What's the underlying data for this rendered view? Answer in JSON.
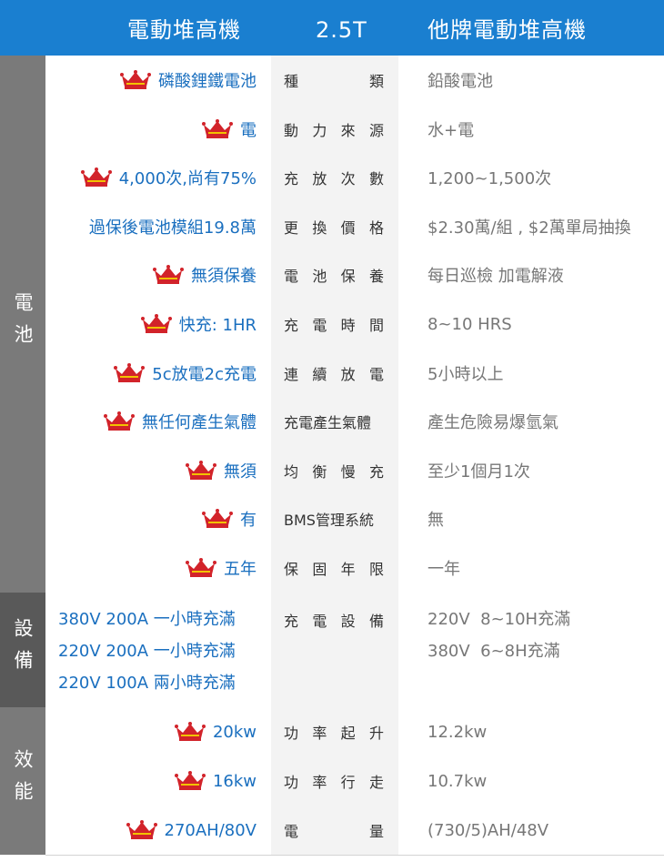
{
  "header": {
    "col1": "電動堆高機",
    "col2": "2.5T",
    "col3": "他牌電動堆高機"
  },
  "colors": {
    "header_bg": "#1a7fd0",
    "highlight": "#1a6fbf",
    "crown_red": "#d2232a",
    "crown_gold": "#f2c200",
    "label_bg": "#f3f3f3",
    "sidebar_battery": "#7a7a7a",
    "sidebar_equip": "#595959",
    "sidebar_perf": "#7a7a7a"
  },
  "sections": {
    "battery": "電池",
    "equipment": "設備",
    "performance": "效能"
  },
  "rows": [
    {
      "ours": "磷酸鋰鐵電池",
      "label": "種類",
      "spaced": true,
      "other": "鉛酸電池",
      "crown": true
    },
    {
      "ours": "電",
      "label": "動力來源",
      "spaced": true,
      "other": "水+電",
      "crown": true
    },
    {
      "ours": "4,000次,尚有75%",
      "label": "充放次數",
      "spaced": true,
      "other": "1,200~1,500次",
      "crown": true
    },
    {
      "ours": "過保後電池模組19.8萬",
      "label": "更換價格",
      "spaced": true,
      "other": "$2.30萬/組 , $2萬單局抽換",
      "crown": false
    },
    {
      "ours": "無須保養",
      "label": "電池保養",
      "spaced": true,
      "other": "每日巡檢 加電解液",
      "crown": true
    },
    {
      "ours": "快充: 1HR",
      "label": "充電時間",
      "spaced": true,
      "other": "8~10 HRS",
      "crown": true
    },
    {
      "ours": "5c放電2c充電",
      "label": "連續放電",
      "spaced": true,
      "other": "5小時以上",
      "crown": true
    },
    {
      "ours": "無任何產生氣體",
      "label": "充電產生氣體",
      "spaced": false,
      "other": "產生危險易爆氫氣",
      "crown": true
    },
    {
      "ours": "無須",
      "label": "均衡慢充",
      "spaced": true,
      "other": "至少1個月1次",
      "crown": true
    },
    {
      "ours": "有",
      "label": "BMS管理系統",
      "spaced": false,
      "other": "無",
      "crown": true
    },
    {
      "ours": "五年",
      "label": "保固年限",
      "spaced": true,
      "other": "一年",
      "crown": true
    }
  ],
  "equipment": {
    "ours": [
      "380V 200A 一小時充滿",
      "220V 200A 一小時充滿",
      "220V 100A 兩小時充滿"
    ],
    "label": "充電設備",
    "other": [
      "220V  8~10H充滿",
      "380V  6~8H充滿"
    ]
  },
  "performance": [
    {
      "ours": "20kw",
      "label": "功率起升",
      "spaced": true,
      "other": "12.2kw",
      "crown": true
    },
    {
      "ours": "16kw",
      "label": "功率行走",
      "spaced": true,
      "other": "10.7kw",
      "crown": true
    },
    {
      "ours": "270AH/80V",
      "label": "電量",
      "spaced": true,
      "other": "(730/5)AH/48V",
      "crown": true
    }
  ]
}
